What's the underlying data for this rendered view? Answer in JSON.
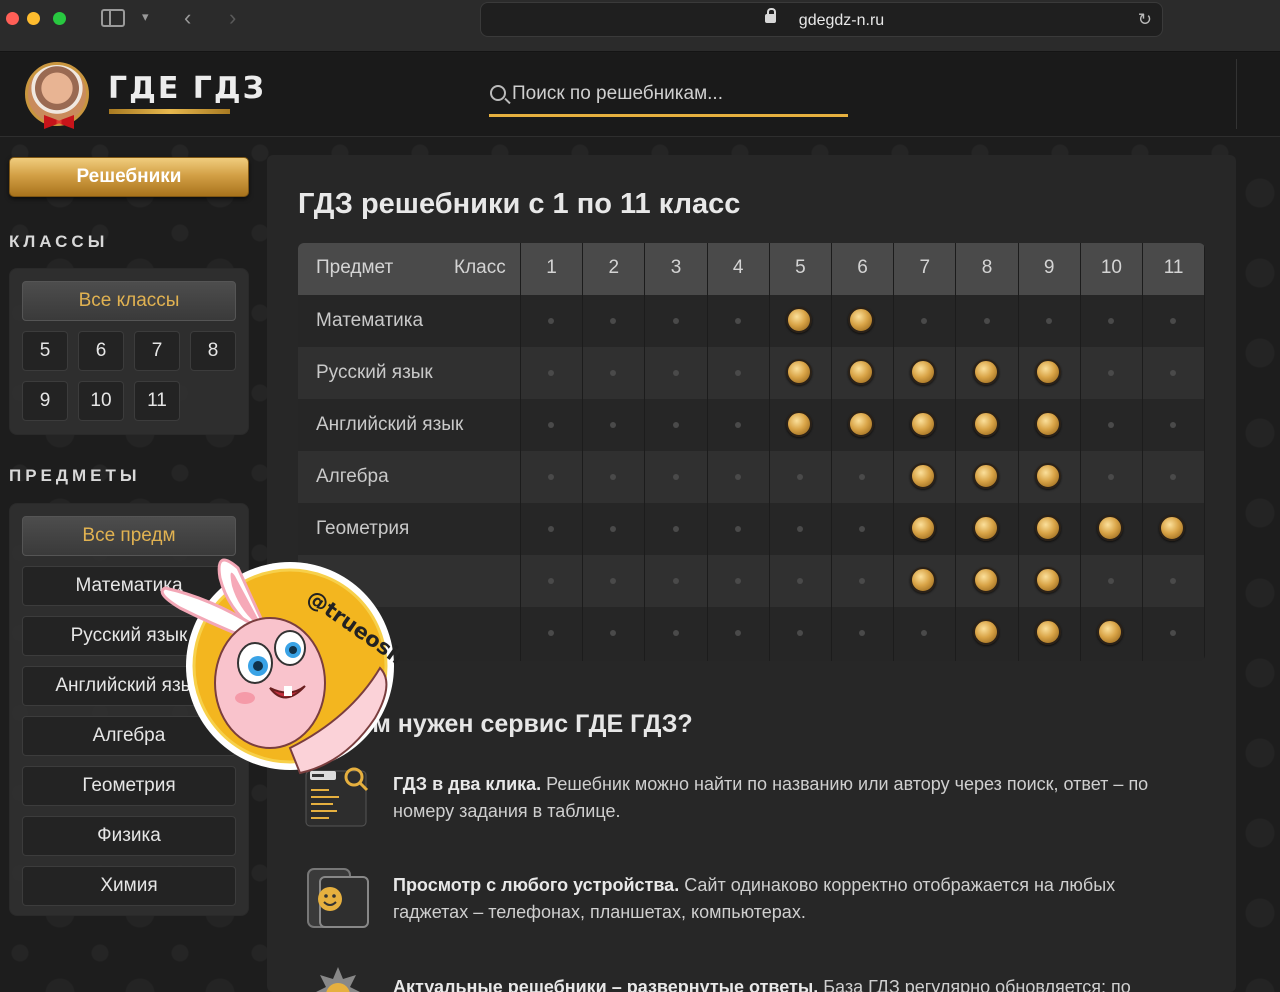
{
  "browser": {
    "url": "gdegdz-n.ru"
  },
  "header": {
    "logo_text": "ГДЕ ГДЗ",
    "search_placeholder": "Поиск по решебникам..."
  },
  "sidebar": {
    "main_button": "Решебники",
    "classes_title": "КЛАССЫ",
    "classes_all": "Все классы",
    "classes": [
      "5",
      "6",
      "7",
      "8",
      "9",
      "10",
      "11"
    ],
    "subjects_title": "ПРЕДМЕТЫ",
    "subjects_all": "Все предм",
    "subjects": [
      "Математика",
      "Русский язык",
      "Английский язык",
      "Алгебра",
      "Геометрия",
      "Физика",
      "Химия"
    ]
  },
  "main": {
    "title": "ГДЗ решебники с 1 по 11 класс",
    "table": {
      "col_subject": "Предмет",
      "col_class": "Класс",
      "grades": [
        "1",
        "2",
        "3",
        "4",
        "5",
        "6",
        "7",
        "8",
        "9",
        "10",
        "11"
      ],
      "rows": [
        {
          "subject": "Математика",
          "available": [
            5,
            6
          ]
        },
        {
          "subject": "Русский язык",
          "available": [
            5,
            6,
            7,
            8,
            9
          ]
        },
        {
          "subject": "Английский язык",
          "available": [
            5,
            6,
            7,
            8,
            9
          ]
        },
        {
          "subject": "Алгебра",
          "available": [
            7,
            8,
            9
          ]
        },
        {
          "subject": "Геометрия",
          "available": [
            7,
            8,
            9,
            10,
            11
          ]
        },
        {
          "subject": "",
          "available": [
            7,
            8,
            9
          ]
        },
        {
          "subject": "",
          "available": [
            8,
            9,
            10
          ]
        }
      ]
    },
    "why_title": "ачем нужен сервис ГДЕ ГДЗ?",
    "features": [
      {
        "icon": "search-book-icon",
        "bold": "ГДЗ в два клика.",
        "text": " Решебник можно найти по названию или автору через поиск, ответ – по номеру задания в таблице."
      },
      {
        "icon": "devices-icon",
        "bold": "Просмотр с любого устройства.",
        "text": " Сайт одинаково корректно отображается на любых гаджетах – телефонах, планшетах, компьютерах."
      },
      {
        "icon": "star-badge-icon",
        "bold": "Актуальные решебники – развернутые ответы.",
        "text": " База ГДЗ регулярно обновляется; по"
      }
    ]
  },
  "sticker": {
    "handle": "@trueosint"
  },
  "colors": {
    "accent_gold": "#e6b03f",
    "background": "#1d1d1d",
    "table_header": "#4a4a4a"
  }
}
